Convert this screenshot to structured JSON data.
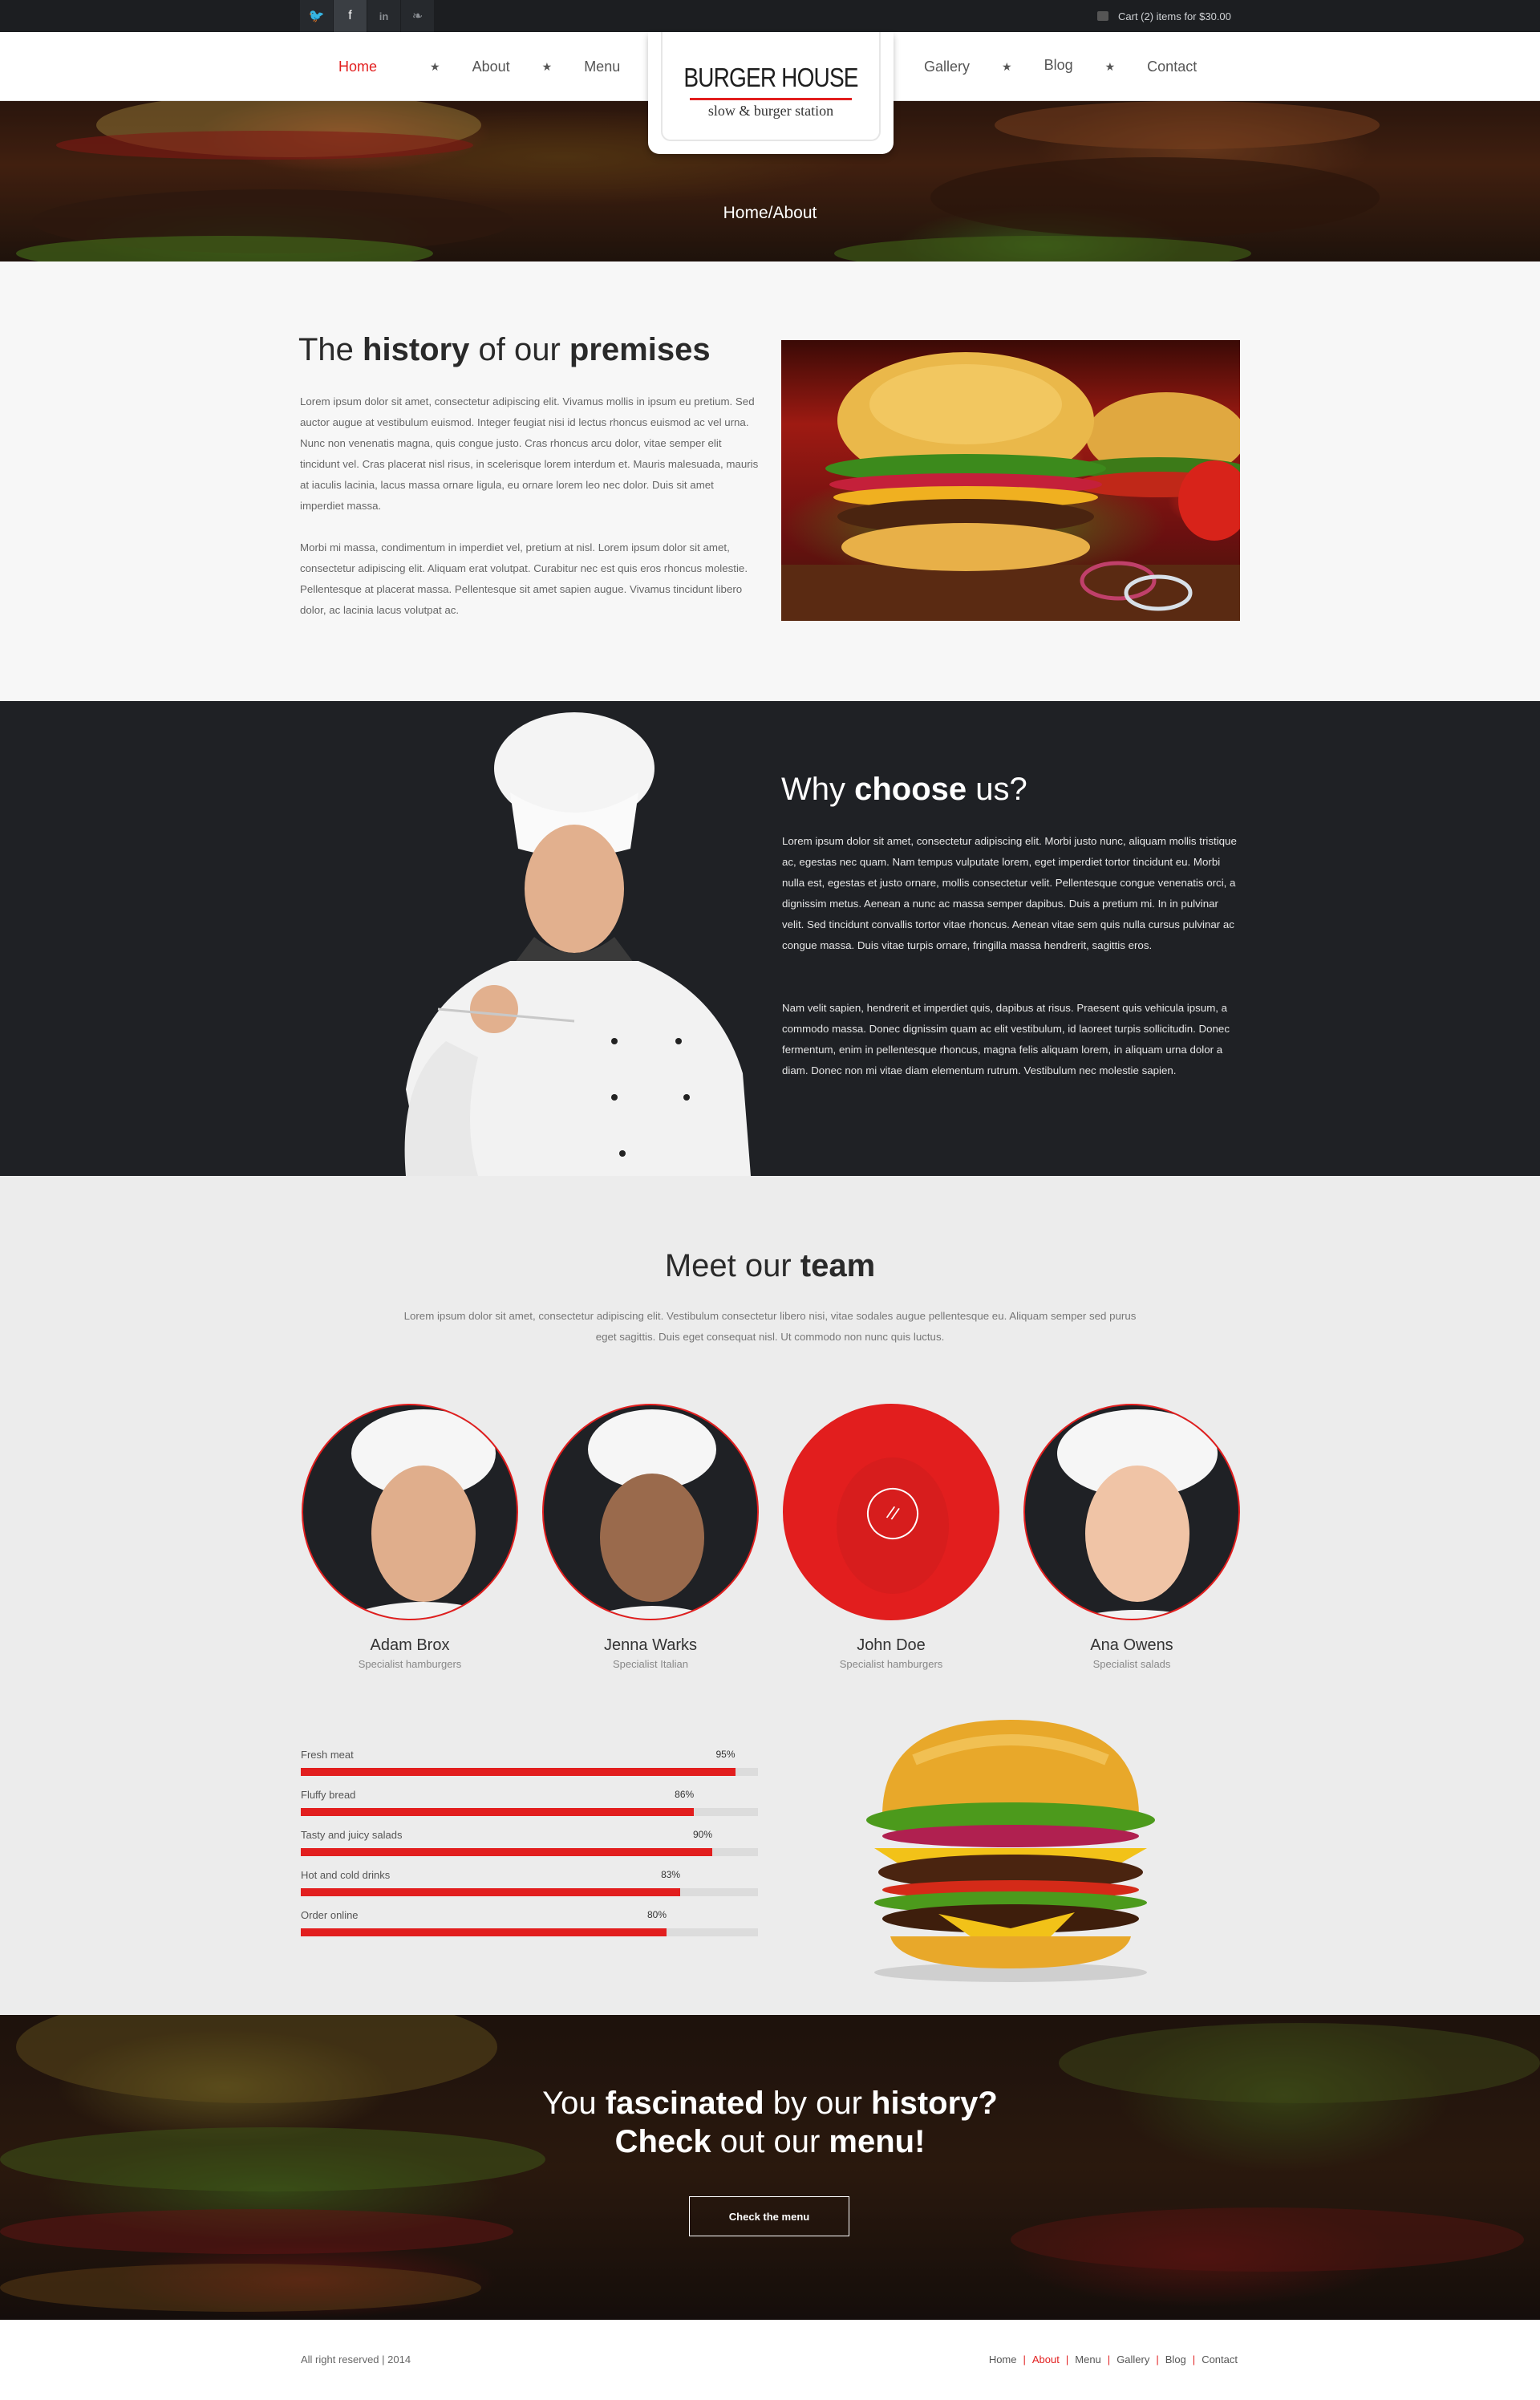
{
  "topbar": {
    "social_icons": [
      "twitter-icon",
      "facebook-icon",
      "linkedin-icon",
      "evernote-icon"
    ],
    "social_glyphs": [
      "🐦",
      "f",
      "in",
      "❧"
    ],
    "cart_text": "Cart (2) items for $30.00"
  },
  "nav": {
    "left": [
      "Home",
      "About",
      "Menu"
    ],
    "right": [
      "Gallery",
      "Blog",
      "Contact"
    ],
    "active": "Home",
    "separator": "★"
  },
  "logo": {
    "title": "BURGER HOUSE",
    "subtitle": "slow & burger station"
  },
  "hero": {
    "breadcrumb": "Home/About"
  },
  "history": {
    "title_pre": "The ",
    "title_b1": "history",
    "title_mid": " of our ",
    "title_b2": "premises",
    "p1": "Lorem ipsum dolor sit amet, consectetur adipiscing elit. Vivamus mollis in ipsum eu pretium. Sed auctor augue at vestibulum euismod. Integer feugiat nisi id lectus rhoncus euismod ac vel urna. Nunc non venenatis magna, quis congue justo. Cras rhoncus arcu dolor, vitae semper elit tincidunt vel. Cras placerat nisl risus, in scelerisque lorem interdum et. Mauris malesuada, mauris at iaculis lacinia, lacus massa ornare ligula, eu ornare lorem leo nec dolor. Duis sit amet imperdiet massa.",
    "p2": "Morbi mi massa, condimentum in imperdiet vel, pretium at nisl. Lorem ipsum dolor sit amet, consectetur adipiscing elit. Aliquam erat volutpat. Curabitur nec est quis eros rhoncus molestie. Pellentesque at placerat massa. Pellentesque sit amet sapien augue. Vivamus tincidunt libero dolor, ac lacinia lacus volutpat ac."
  },
  "why": {
    "title_pre": "Why ",
    "title_b": "choose",
    "title_post": " us?",
    "p1": "Lorem ipsum dolor sit amet, consectetur adipiscing elit. Morbi justo nunc, aliquam mollis tristique ac, egestas nec quam. Nam tempus vulputate lorem, eget imperdiet tortor tincidunt eu. Morbi nulla est, egestas et justo ornare, mollis consectetur velit. Pellentesque congue venenatis orci, a dignissim metus. Aenean a nunc ac massa semper dapibus. Duis a pretium mi. In in pulvinar velit. Sed tincidunt convallis tortor vitae rhoncus. Aenean vitae sem quis nulla cursus pulvinar ac congue massa. Duis vitae turpis ornare, fringilla massa hendrerit, sagittis eros.",
    "p2": "Nam velit sapien, hendrerit et imperdiet quis, dapibus at risus. Praesent quis vehicula ipsum, a commodo massa. Donec dignissim quam ac elit vestibulum, id laoreet turpis sollicitudin. Donec fermentum, enim in pellentesque rhoncus, magna felis aliquam lorem, in aliquam urna dolor a diam. Donec non mi vitae diam elementum rutrum. Vestibulum nec molestie sapien."
  },
  "team": {
    "title_pre": "Meet our ",
    "title_b": "team",
    "intro": "Lorem ipsum dolor sit amet, consectetur adipiscing elit. Vestibulum consectetur libero nisi, vitae sodales augue pellentesque eu. Aliquam semper sed purus eget sagittis. Duis eget consequat nisl. Ut commodo non nunc quis luctus.",
    "members": [
      {
        "name": "Adam Brox",
        "role": "Specialist hamburgers"
      },
      {
        "name": "Jenna Warks",
        "role": "Specialist Italian"
      },
      {
        "name": "John Doe",
        "role": "Specialist hamburgers"
      },
      {
        "name": "Ana Owens",
        "role": "Specialist salads"
      }
    ],
    "hover_icon": "link-icon"
  },
  "skills": [
    {
      "label": "Fresh meat",
      "percent": 95
    },
    {
      "label": "Fluffy bread",
      "percent": 86
    },
    {
      "label": "Tasty and juicy salads",
      "percent": 90
    },
    {
      "label": "Hot and cold drinks",
      "percent": 83
    },
    {
      "label": "Order online",
      "percent": 80
    }
  ],
  "cta": {
    "l1_pre": "You ",
    "l1_b1": "fascinated",
    "l1_mid": " by our ",
    "l1_b2": "history?",
    "l2_b1": "Check",
    "l2_mid": " out our ",
    "l2_b2": "menu!",
    "button": "Check the menu"
  },
  "footer": {
    "copyright": "All right reserved | 2014",
    "links": [
      "Home",
      "About",
      "Menu",
      "Gallery",
      "Blog",
      "Contact"
    ],
    "active": "About"
  },
  "colors": {
    "accent": "#e21e1e",
    "dark": "#1f2125",
    "light_bg": "#ececec"
  }
}
